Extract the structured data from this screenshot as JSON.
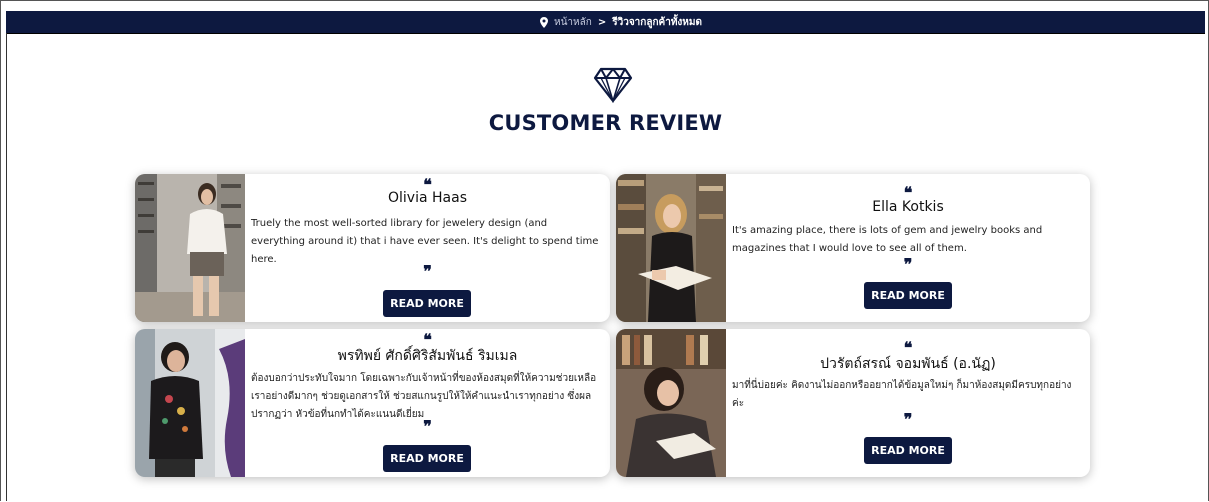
{
  "breadcrumb": {
    "home": "หน้าหลัก",
    "separator": ">",
    "current": "รีวิวจากลูกค้าทั้งหมด"
  },
  "page_title": "CUSTOMER REVIEW",
  "quote_open": "❝",
  "quote_close": "❞",
  "reviews": [
    {
      "name": "Olivia Haas",
      "text": "Truely the most well-sorted library for jewelery design (and everything around it) that i have ever seen. It's delight to spend time here.",
      "button": "READ MORE"
    },
    {
      "name": "Ella Kotkis",
      "text": "It's amazing place, there is lots of gem and jewelry books and magazines that I would love to see all of them.",
      "button": "READ MORE"
    },
    {
      "name": "พรทิพย์ ศักดิ์ศิริสัมพันธ์ ริมเมล",
      "text": "ต้องบอกว่าประทับใจมาก โดยเฉพาะกับเจ้าหน้าที่ของห้องสมุดที่ให้ความช่วยเหลือเราอย่างดีมากๆ ช่วยดูเอกสารให้ ช่วยสแกนรูปให้ให้คำแนะนำเราทุกอย่าง ซึ่งผลปรากฏว่า หัวข้อที่นกทำได้คะแนนดีเยี่ยม",
      "button": "READ MORE"
    },
    {
      "name": "ปวรัตถ์สรณ์ จอมพันธ์ (อ.นัฏ)",
      "text": "มาที่นี่บ่อยค่ะ คิดงานไม่ออกหรืออยากได้ข้อมูลใหม่ๆ ก็มาห้องสมุดมีครบทุกอย่างค่ะ",
      "button": "READ MORE"
    }
  ],
  "colors": {
    "navy": "#0d1940",
    "white": "#ffffff"
  }
}
